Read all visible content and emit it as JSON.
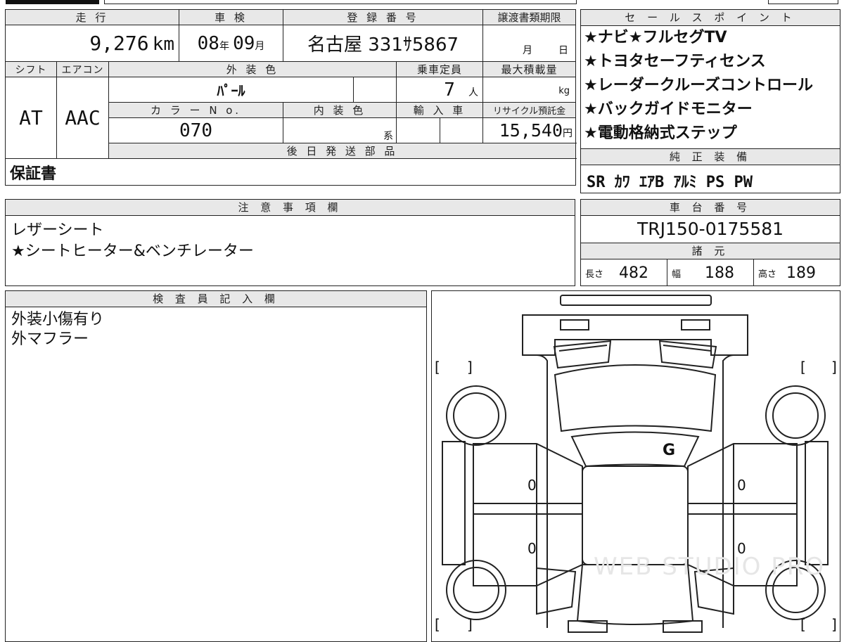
{
  "vehicle": {
    "mileage": {
      "label": "走 行",
      "value": "9,276",
      "unit": "km"
    },
    "inspection": {
      "label": "車 検",
      "year": "08",
      "year_unit": "年",
      "month": "09",
      "month_unit": "月"
    },
    "registration": {
      "label": "登 録 番 号",
      "value": "名古屋 331ｻ5867"
    },
    "transfer_deadline": {
      "label": "譲渡書類期限",
      "month_unit": "月",
      "day_unit": "日"
    },
    "shift": {
      "label": "シフト",
      "value": "AT"
    },
    "aircon": {
      "label": "エアコン",
      "value": "AAC"
    },
    "exterior_color": {
      "label": "外 装 色",
      "value": "ﾊﾟｰﾙ"
    },
    "capacity": {
      "label": "乗車定員",
      "value": "7",
      "unit": "人"
    },
    "max_load": {
      "label": "最大積載量",
      "unit": "kg"
    },
    "color_no": {
      "label": "カ ラ ー N o.",
      "value": "070"
    },
    "interior_color": {
      "label": "内 装 色",
      "suffix": "系"
    },
    "import": {
      "label": "輸 入 車"
    },
    "recycle_fee": {
      "label": "リサイクル預託金",
      "value": "15,540",
      "unit": "円"
    }
  },
  "sales_points": {
    "title": "セ ー ル ス ポ イ ン ト",
    "items": [
      "★ナビ★フルセグTV",
      "★トヨタセーフティセンス",
      "★レーダークルーズコントロール",
      "★バックガイドモニター",
      "★電動格納式ステップ"
    ]
  },
  "later_parts": {
    "title": "後 日 発 送 部 品",
    "value": "保証書"
  },
  "genuine_equipment": {
    "title": "純 正 装 備",
    "value": "SR ｶﾜ ｴｱB ｱﾙﾐ PS PW"
  },
  "notes": {
    "title": "注 意 事 項 欄",
    "lines": [
      "レザーシート",
      "★シートヒーター&ベンチレーター"
    ]
  },
  "chassis": {
    "title": "車 台 番 号",
    "value": "TRJ150-0175581"
  },
  "specs": {
    "title": "諸 元",
    "length": {
      "label": "長さ",
      "value": "482"
    },
    "width": {
      "label": "幅",
      "value": "188"
    },
    "height": {
      "label": "高さ",
      "value": "189"
    }
  },
  "inspector": {
    "title": "検 査 員 記 入 欄",
    "lines": [
      "外装小傷有り",
      "外マフラー"
    ]
  },
  "diagram": {
    "marks": [
      "G",
      "0",
      "0",
      "0",
      "0"
    ],
    "bracket_open": "[",
    "bracket_close": "]",
    "watermark": "WEB STUDIO PRO"
  }
}
